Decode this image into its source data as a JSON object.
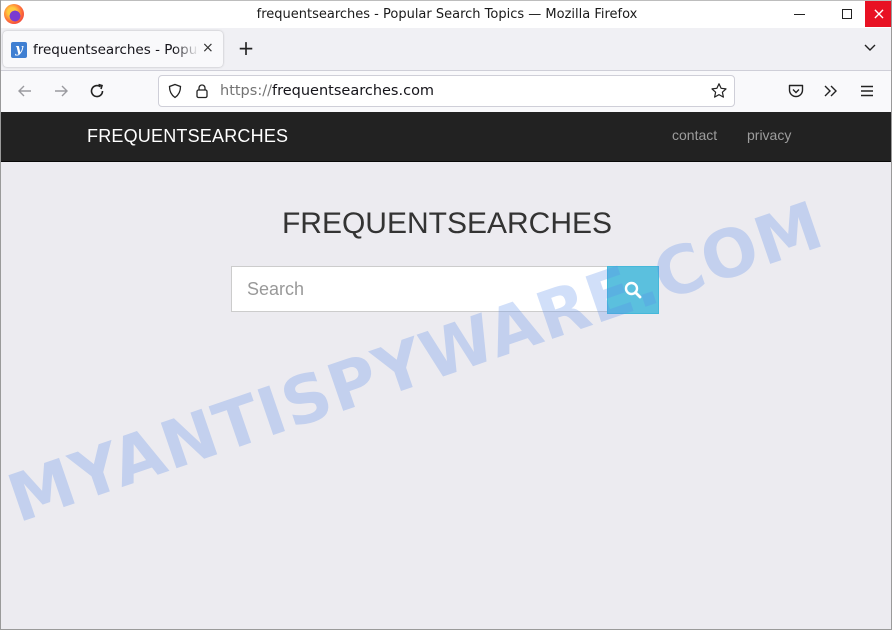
{
  "window": {
    "title": "frequentsearches - Popular Search Topics — Mozilla Firefox",
    "controls": {
      "minimize": "minimize",
      "maximize": "maximize",
      "close": "×"
    }
  },
  "tabs": [
    {
      "favicon": "y",
      "title": "frequentsearches - Popular Search Topics",
      "close": "×",
      "active": true
    }
  ],
  "tabstrip": {
    "new_tab": "+"
  },
  "navbar": {
    "url_scheme": "https://",
    "url_host": "frequentsearches.com",
    "icons": [
      "back-icon",
      "forward-icon",
      "reload-icon",
      "shield-icon",
      "lock-icon",
      "star-icon",
      "pocket-icon",
      "overflow-icon",
      "menu-icon"
    ]
  },
  "site": {
    "brand": "FREQUENTSEARCHES",
    "nav": [
      {
        "label": "contact"
      },
      {
        "label": "privacy"
      }
    ],
    "hero_title": "FREQUENTSEARCHES",
    "search": {
      "placeholder": "Search",
      "value": "",
      "button_icon": "search-icon"
    },
    "accent_color": "#5bc0de",
    "header_bg": "#222222"
  },
  "watermark": "MYANTISPYWARE.COM"
}
